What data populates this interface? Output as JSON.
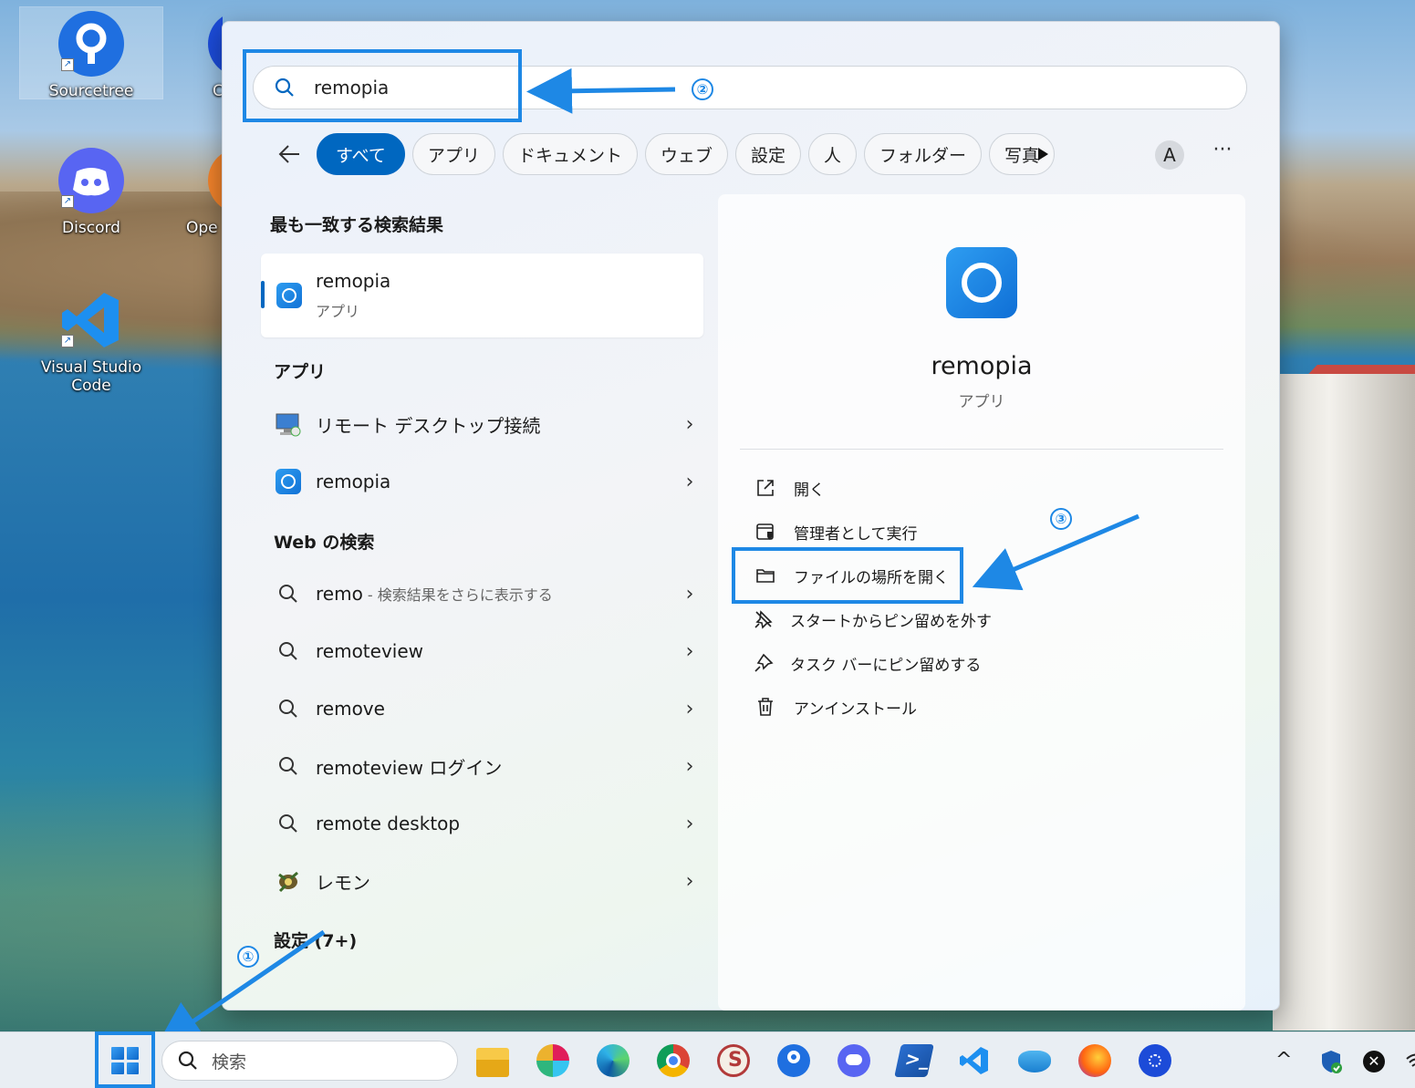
{
  "desktop": {
    "icons": [
      {
        "label": "Sourcetree",
        "color": "#1f6fe0"
      },
      {
        "label": "Discord",
        "color": "#5865f2"
      },
      {
        "label": "Visual Studio Code",
        "color": "#1d8ff0"
      },
      {
        "label": "C",
        "color": "#1c4bd8"
      },
      {
        "label": "Ope",
        "color": "#f0822b"
      }
    ]
  },
  "search": {
    "query": "remopia"
  },
  "filters": [
    "すべて",
    "アプリ",
    "ドキュメント",
    "ウェブ",
    "設定",
    "人",
    "フォルダー",
    "写真"
  ],
  "avatar_letter": "A",
  "more_label": "···",
  "results": {
    "best_match_heading": "最も一致する検索結果",
    "best_match": {
      "name": "remopia",
      "type": "アプリ"
    },
    "apps_heading": "アプリ",
    "apps": [
      {
        "name": "リモート デスクトップ接続"
      },
      {
        "name": "remopia"
      }
    ],
    "web_heading": "Web の検索",
    "web": [
      {
        "term": "remo",
        "suffix": " - 検索結果をさらに表示する"
      },
      {
        "term": "remoteview",
        "suffix": ""
      },
      {
        "term": "remove",
        "suffix": ""
      },
      {
        "term": "remoteview ログイン",
        "suffix": ""
      },
      {
        "term": "remote desktop",
        "suffix": ""
      },
      {
        "term": "レモン",
        "suffix": ""
      }
    ],
    "settings_heading": "設定 (7+)"
  },
  "detail": {
    "name": "remopia",
    "type": "アプリ",
    "actions": [
      "開く",
      "管理者として実行",
      "ファイルの場所を開く",
      "スタートからピン留めを外す",
      "タスク バーにピン留めする",
      "アンインストール"
    ]
  },
  "annotations": {
    "m1": "①",
    "m2": "②",
    "m3": "③",
    "accent": "#1e88e5"
  },
  "taskbar": {
    "search_placeholder": "検索",
    "apps": [
      "file-explorer",
      "slack",
      "edge",
      "chrome",
      "sakura-editor",
      "sourcetree",
      "discord",
      "powershell",
      "vscode",
      "onedrive",
      "firefox",
      "remopia-taskbar"
    ],
    "tray_chevron": "^"
  }
}
